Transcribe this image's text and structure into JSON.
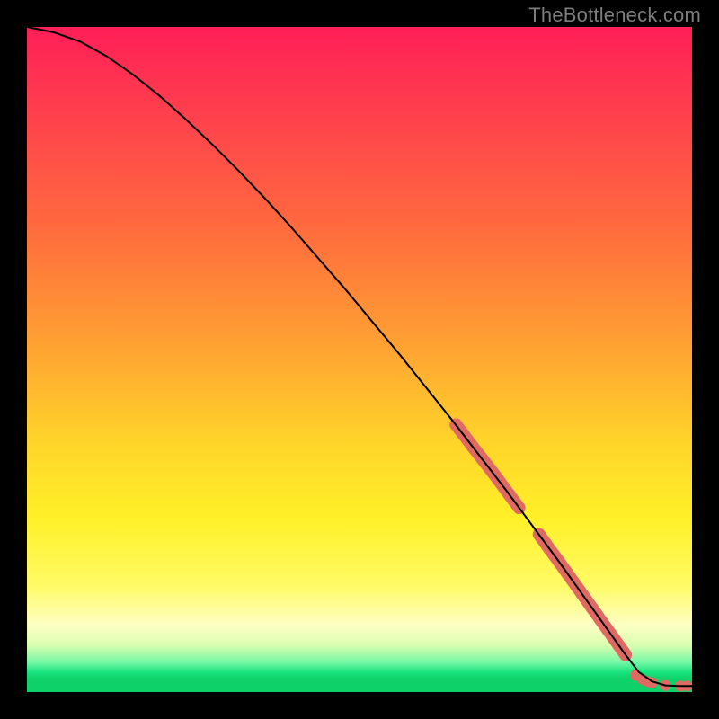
{
  "watermark": "TheBottleneck.com",
  "chart_data": {
    "type": "line",
    "title": "",
    "xlabel": "",
    "ylabel": "",
    "xlim": [
      0,
      100
    ],
    "ylim": [
      0,
      100
    ],
    "series": [
      {
        "name": "curve",
        "color": "#000000",
        "x": [
          0,
          4,
          8,
          12,
          16,
          20,
          24,
          28,
          32,
          36,
          40,
          44,
          48,
          52,
          56,
          60,
          64,
          68,
          72,
          76,
          80,
          82,
          84,
          86,
          88,
          90,
          92,
          94,
          96,
          98,
          100
        ],
        "y": [
          100,
          99.2,
          97.8,
          95.6,
          92.8,
          89.6,
          86.0,
          82.2,
          78.2,
          74.0,
          69.6,
          65.0,
          60.4,
          55.6,
          50.8,
          45.8,
          40.8,
          35.6,
          30.4,
          25.0,
          19.6,
          16.8,
          14.0,
          11.2,
          8.4,
          5.6,
          3.0,
          1.6,
          1.0,
          0.9,
          0.9
        ]
      }
    ],
    "markers": [
      {
        "name": "highlight-segment",
        "color": "#e06a63",
        "shape": "pill",
        "points": [
          {
            "x": 64.5,
            "y": 40.2
          },
          {
            "x": 65.5,
            "y": 38.9
          },
          {
            "x": 67.0,
            "y": 36.9
          },
          {
            "x": 68.5,
            "y": 35.0
          },
          {
            "x": 70.5,
            "y": 32.4
          },
          {
            "x": 72.5,
            "y": 29.7
          },
          {
            "x": 74.0,
            "y": 27.7
          },
          {
            "x": 77.0,
            "y": 23.7
          },
          {
            "x": 78.5,
            "y": 21.6
          },
          {
            "x": 80.0,
            "y": 19.6
          },
          {
            "x": 81.2,
            "y": 17.9
          },
          {
            "x": 82.5,
            "y": 16.1
          },
          {
            "x": 83.5,
            "y": 14.7
          },
          {
            "x": 85.0,
            "y": 12.6
          },
          {
            "x": 86.5,
            "y": 10.5
          },
          {
            "x": 88.0,
            "y": 8.4
          },
          {
            "x": 89.0,
            "y": 7.0
          },
          {
            "x": 90.0,
            "y": 5.6
          }
        ]
      },
      {
        "name": "baseline-dots",
        "color": "#e06a63",
        "shape": "dot",
        "points": [
          {
            "x": 91.5,
            "y": 2.5
          },
          {
            "x": 92.5,
            "y": 1.9
          },
          {
            "x": 93.3,
            "y": 1.6
          },
          {
            "x": 94.0,
            "y": 1.4
          },
          {
            "x": 96.0,
            "y": 1.0
          },
          {
            "x": 98.2,
            "y": 0.9
          },
          {
            "x": 99.2,
            "y": 0.9
          }
        ]
      }
    ]
  }
}
